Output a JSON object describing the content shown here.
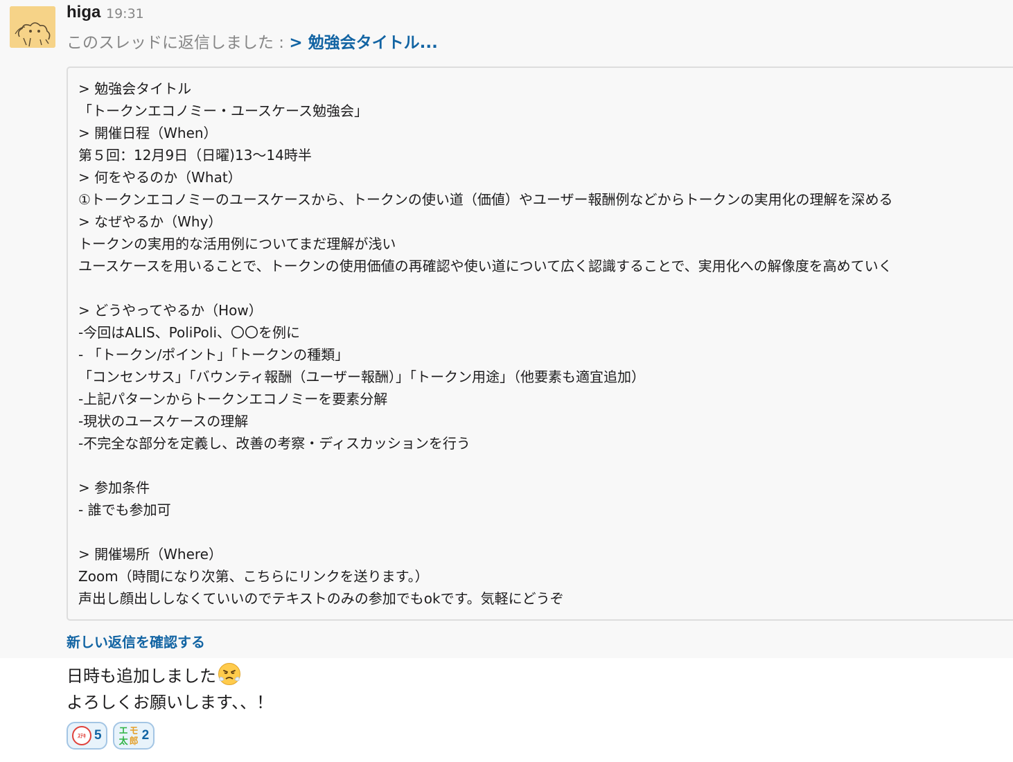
{
  "message": {
    "username": "higa",
    "time": "19:31",
    "thread_prefix": "このスレッドに返信しました : ",
    "thread_link": "> 勉強会タイトル...",
    "quote_text": "> 勉強会タイトル\n「トークンエコノミー・ユースケース勉強会」\n> 開催日程（When）\n第５回：12月9日（日曜)13〜14時半\n> 何をやるのか（What）\n①トークンエコノミーのユースケースから、トークンの使い道（価値）やユーザー報酬例などからトークンの実用化の理解を深める\n> なぜやるか（Why）\nトークンの実用的な活用例についてまだ理解が浅い\nユースケースを用いることで、トークンの使用価値の再確認や使い道について広く認識することで、実用化への解像度を高めていく\n\n> どうやってやるか（How）\n-今回はALIS、PoliPoli、〇〇を例に\n- 「トークン/ポイント」「トークンの種類」\n「コンセンサス」「バウンティ報酬（ユーザー報酬）」「トークン用途」（他要素も適宜追加）\n-上記パターンからトークンエコノミーを要素分解\n-現状のユースケースの理解\n-不完全な部分を定義し、改善の考察・ディスカッションを行う\n\n> 参加条件\n- 誰でも参加可\n\n> 開催場所（Where）\nZoom（時間になり次第、こちらにリンクを送ります。）\n声出し顔出ししなくていいのでテキストのみの参加でもokです。気軽にどうぞ",
    "see_new_replies": "新しい返信を確認する",
    "body_line1": "日時も追加しました",
    "body_line2": "よろしくお願いします、、！"
  },
  "reactions": [
    {
      "icon": "suteki-icon",
      "icon_text": "ｽﾃｷ",
      "count": "5"
    },
    {
      "icon": "emotaro-icon",
      "icon_text": [
        "エ",
        "モ",
        "太",
        "郎"
      ],
      "count": "2"
    }
  ],
  "colors": {
    "link": "#1264a3",
    "muted": "#868686",
    "highlight_bg": "#f8f8f8",
    "reaction_border": "#a3c5e4"
  }
}
